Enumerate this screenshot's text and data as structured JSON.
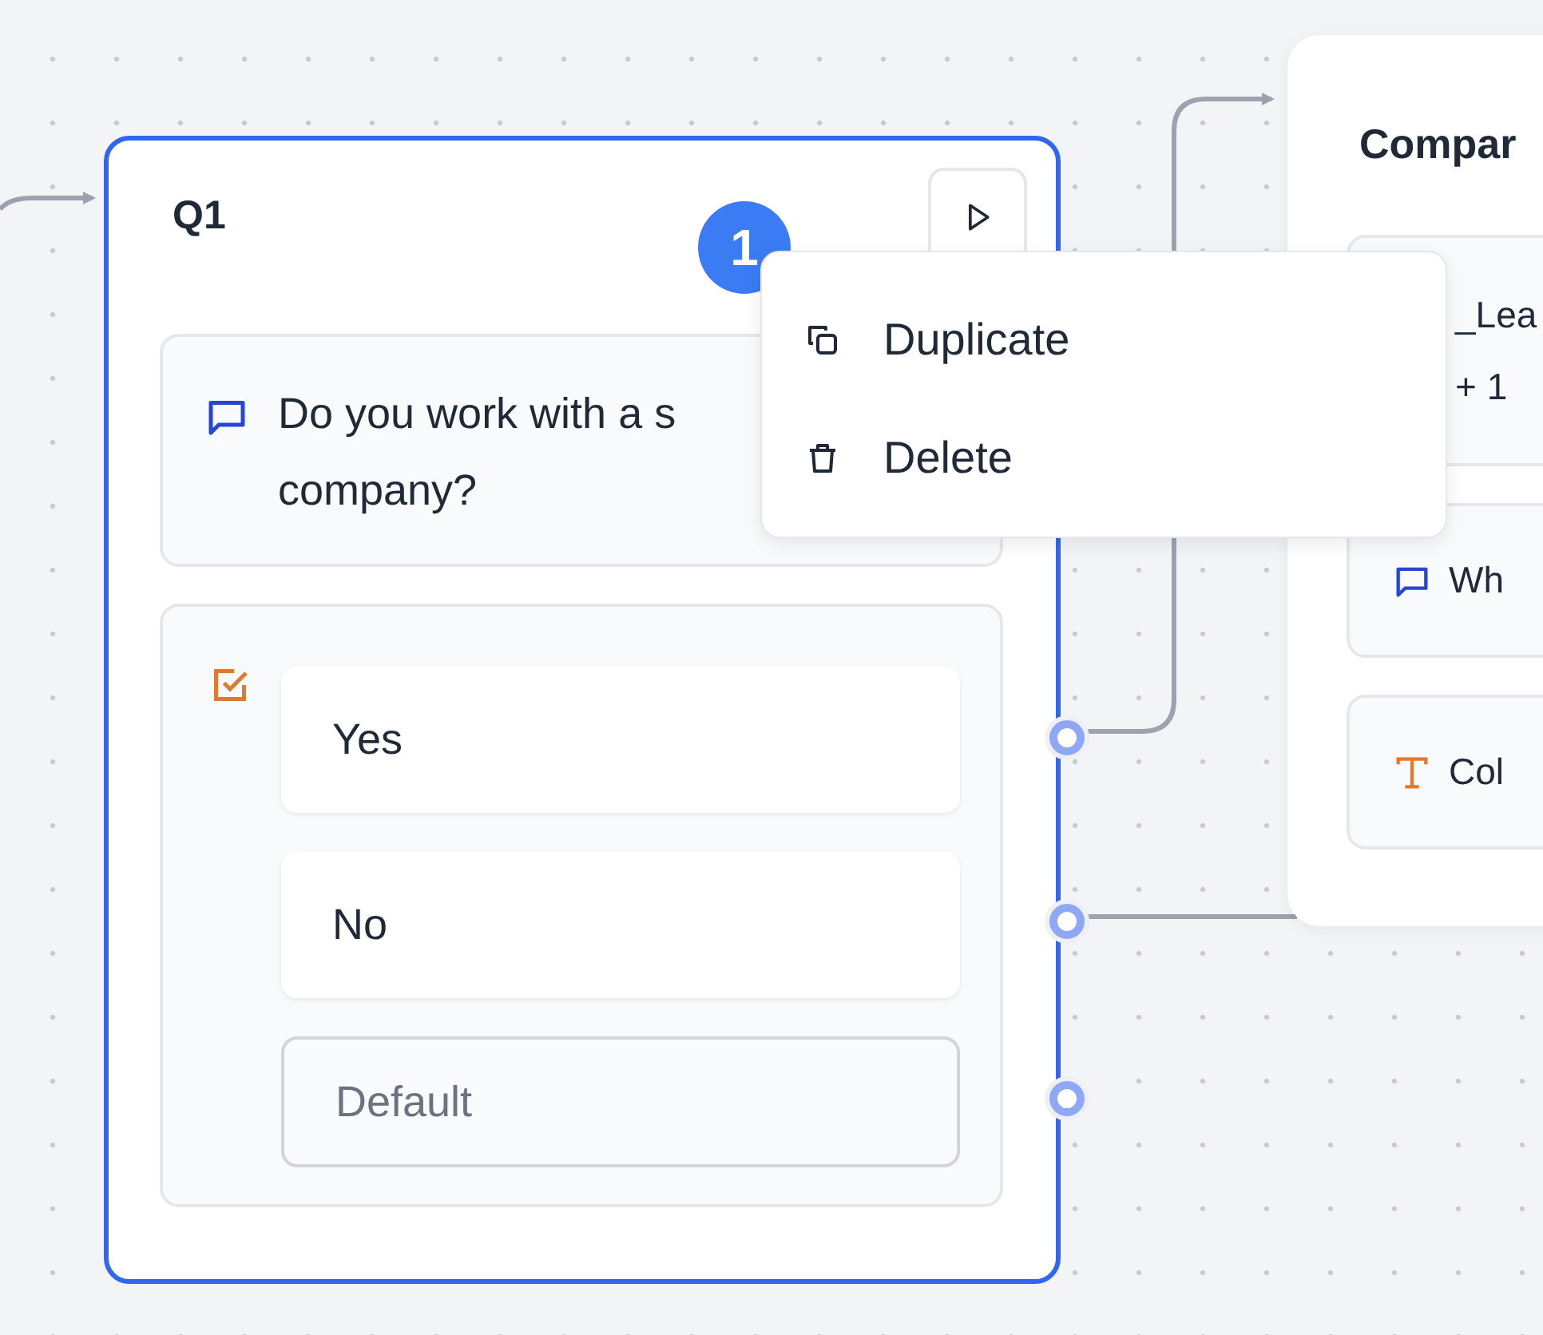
{
  "q1_node": {
    "title": "Q1",
    "selected": true,
    "badge": "1",
    "message": {
      "lines": [
        "Do you work with a s",
        "company?"
      ]
    },
    "choices": [
      {
        "label": "Yes",
        "kind": "choice"
      },
      {
        "label": "No",
        "kind": "choice"
      },
      {
        "label": "Default",
        "kind": "default"
      }
    ]
  },
  "context_menu": {
    "items": [
      {
        "label": "Duplicate",
        "kind": "duplicate"
      },
      {
        "label": "Delete",
        "kind": "delete"
      }
    ]
  },
  "company_node": {
    "title": "Compar",
    "blocks": [
      {
        "kind": "variable",
        "lines": [
          "_Lea",
          "+ 1"
        ]
      },
      {
        "kind": "message",
        "lines": [
          "Wh"
        ]
      },
      {
        "kind": "text_input",
        "lines": [
          "Col"
        ]
      }
    ]
  }
}
